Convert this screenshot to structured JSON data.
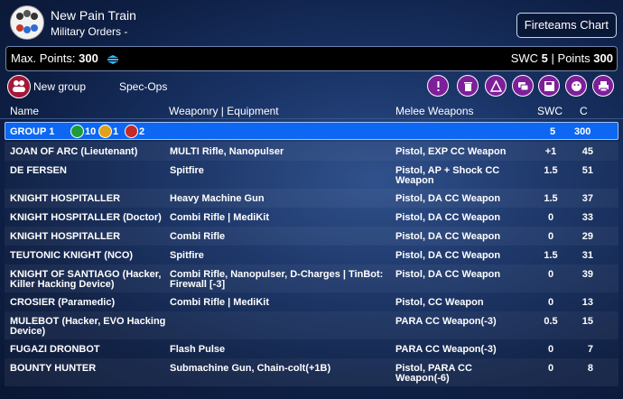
{
  "header": {
    "title": "New Pain Train",
    "subtitle": "Military Orders -",
    "fireteams_label": "Fireteams Chart"
  },
  "points": {
    "label": "Max. Points:",
    "max": "300",
    "swc_label": "SWC",
    "swc_value": "5",
    "sep": "|",
    "points_label": "Points",
    "points_value": "300"
  },
  "toolbar": {
    "new_group": "New group",
    "spec_ops": "Spec-Ops"
  },
  "columns": {
    "name": "Name",
    "weapons": "Weaponry | Equipment",
    "melee": "Melee Weapons",
    "swc": "SWC",
    "c": "C"
  },
  "group": {
    "label": "GROUP 1",
    "regular": "10",
    "irregular": "1",
    "impetuous": "2",
    "swc": "5",
    "c": "300"
  },
  "rows": [
    {
      "name": [
        "JOAN OF ARC (Lieutenant)"
      ],
      "weapons": [
        "MULTI Rifle, Nanopulser"
      ],
      "melee": [
        "Pistol, EXP CC Weapon"
      ],
      "swc": "+1",
      "c": "45"
    },
    {
      "name": [
        "DE FERSEN"
      ],
      "weapons": [
        "Spitfire"
      ],
      "melee": [
        "Pistol, AP + Shock CC",
        "Weapon"
      ],
      "swc": "1.5",
      "c": "51"
    },
    {
      "name": [
        "KNIGHT HOSPITALLER"
      ],
      "weapons": [
        "Heavy Machine Gun"
      ],
      "melee": [
        "Pistol, DA CC Weapon"
      ],
      "swc": "1.5",
      "c": "37"
    },
    {
      "name": [
        "KNIGHT HOSPITALLER (Doctor)"
      ],
      "weapons": [
        "Combi Rifle | MediKit"
      ],
      "melee": [
        "Pistol, DA CC Weapon"
      ],
      "swc": "0",
      "c": "33"
    },
    {
      "name": [
        "KNIGHT HOSPITALLER"
      ],
      "weapons": [
        "Combi Rifle"
      ],
      "melee": [
        "Pistol, DA CC Weapon"
      ],
      "swc": "0",
      "c": "29"
    },
    {
      "name": [
        "TEUTONIC KNIGHT (NCO)"
      ],
      "weapons": [
        "Spitfire"
      ],
      "melee": [
        "Pistol, DA CC Weapon"
      ],
      "swc": "1.5",
      "c": "31"
    },
    {
      "name": [
        "KNIGHT OF SANTIAGO (Hacker,",
        "Killer Hacking Device)"
      ],
      "weapons": [
        "Combi Rifle, Nanopulser, D-Charges | TinBot:",
        "Firewall [-3]"
      ],
      "melee": [
        "Pistol, DA CC Weapon"
      ],
      "swc": "0",
      "c": "39"
    },
    {
      "name": [
        "CROSIER (Paramedic)"
      ],
      "weapons": [
        "Combi Rifle | MediKit"
      ],
      "melee": [
        "Pistol, CC Weapon"
      ],
      "swc": "0",
      "c": "13"
    },
    {
      "name": [
        "MULEBOT (Hacker, EVO Hacking",
        "Device)"
      ],
      "weapons": [
        ""
      ],
      "melee": [
        "PARA CC Weapon(-3)"
      ],
      "swc": "0.5",
      "c": "15"
    },
    {
      "name": [
        "FUGAZI DRONBOT"
      ],
      "weapons": [
        "Flash Pulse"
      ],
      "melee": [
        "PARA CC Weapon(-3)"
      ],
      "swc": "0",
      "c": "7"
    },
    {
      "name": [
        "BOUNTY HUNTER"
      ],
      "weapons": [
        "Submachine Gun, Chain-colt(+1B)"
      ],
      "melee": [
        "Pistol, PARA CC",
        "Weapon(-6)"
      ],
      "swc": "0",
      "c": "8"
    }
  ]
}
